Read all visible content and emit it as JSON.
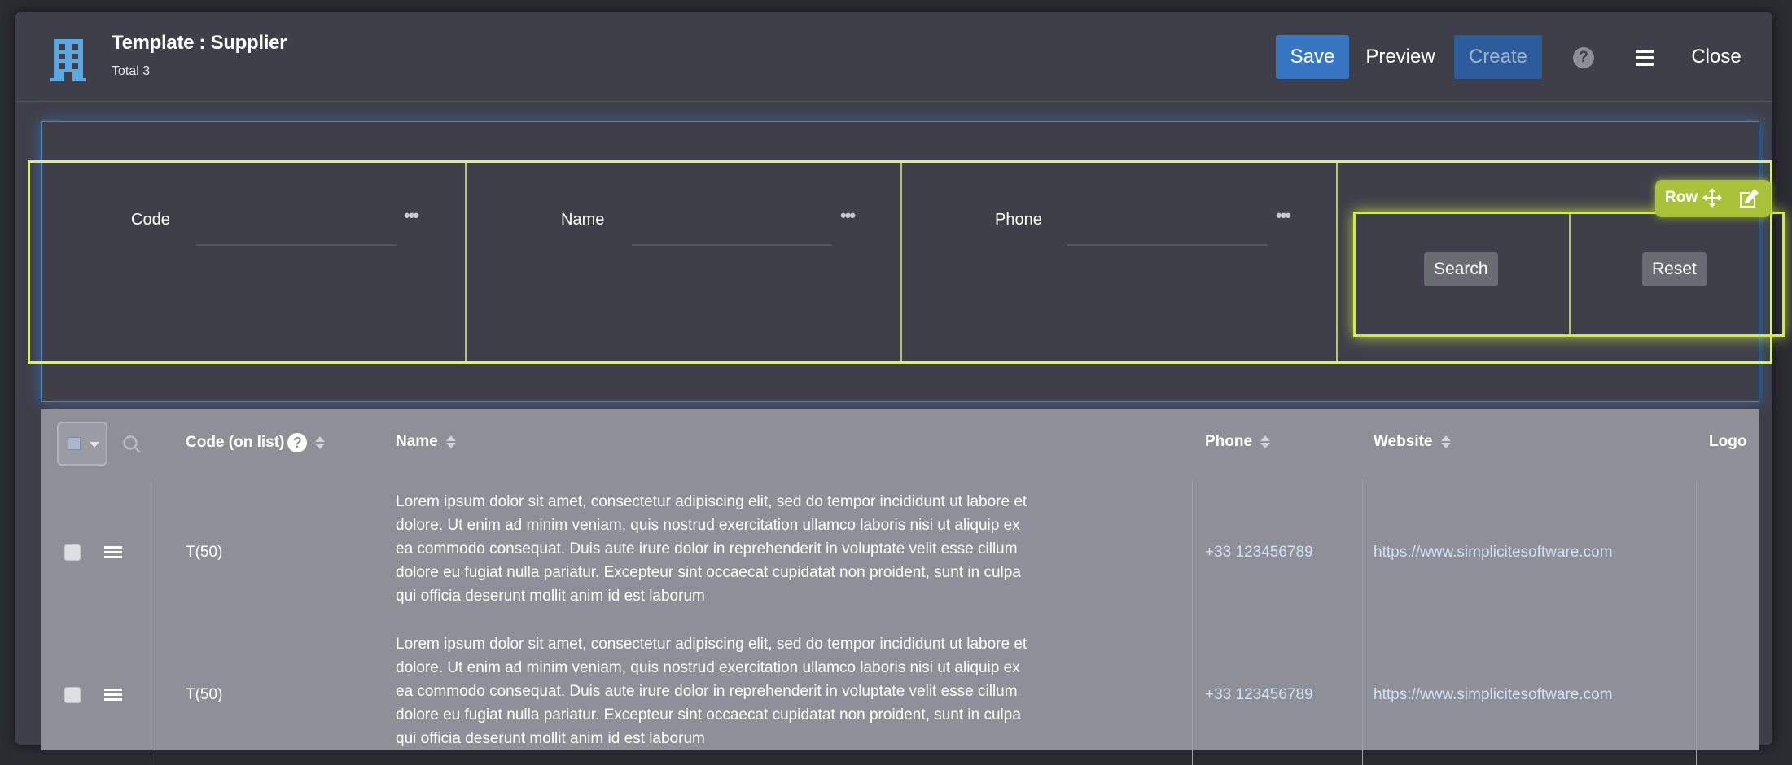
{
  "header": {
    "title": "Template : Supplier",
    "subtitle": "Total 3",
    "icon": "building-icon",
    "buttons": {
      "save": "Save",
      "preview": "Preview",
      "create": "Create",
      "close": "Close"
    }
  },
  "search_form": {
    "fields": [
      {
        "label": "Code"
      },
      {
        "label": "Name"
      },
      {
        "label": "Phone"
      }
    ],
    "search_label": "Search",
    "reset_label": "Reset",
    "row_tag": "Row"
  },
  "table": {
    "columns": [
      "Code (on list)",
      "Name",
      "Phone",
      "Website",
      "Logo"
    ],
    "rows": [
      {
        "code": "T(50)",
        "name": "Lorem ipsum dolor sit amet, consectetur adipiscing elit, sed do tempor incididunt ut labore et dolore. Ut enim ad minim veniam, quis nostrud exercitation ullamco laboris nisi ut aliquip ex ea commodo consequat. Duis aute irure dolor in reprehenderit in voluptate velit esse cillum dolore eu fugiat nulla pariatur. Excepteur sint occaecat cupidatat non proident, sunt in culpa qui officia deserunt mollit anim id est laborum",
        "phone": "+33 123456789",
        "website": "https://www.simplicitesoftware.com"
      },
      {
        "code": "T(50)",
        "name": "Lorem ipsum dolor sit amet, consectetur adipiscing elit, sed do tempor incididunt ut labore et dolore. Ut enim ad minim veniam, quis nostrud exercitation ullamco laboris nisi ut aliquip ex ea commodo consequat. Duis aute irure dolor in reprehenderit in voluptate velit esse cillum dolore eu fugiat nulla pariatur. Excepteur sint occaecat cupidatat non proident, sunt in culpa qui officia deserunt mollit anim id est laborum",
        "phone": "+33 123456789",
        "website": "https://www.simplicitesoftware.com"
      }
    ]
  },
  "colors": {
    "background": "#2b2b32",
    "panel": "#3f3f4a",
    "primary_button": "#3776c2",
    "row_highlight": "#d3eb45",
    "search_border": "#3d8ad8",
    "table_bg": "#8f8f97",
    "link": "#cfe0f7"
  }
}
